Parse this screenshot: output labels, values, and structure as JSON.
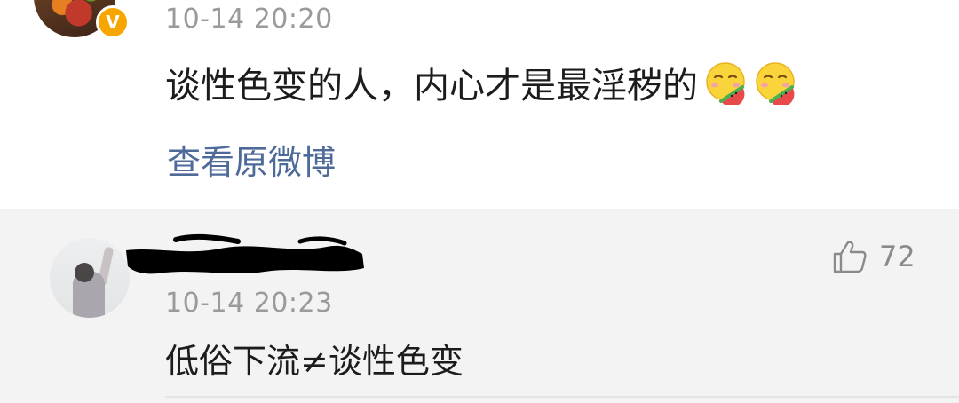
{
  "top_comment": {
    "timestamp": "10-14 20:20",
    "text": "谈性色变的人，内心才是最淫秽的",
    "emojis": [
      "melon-eating-emoji",
      "melon-eating-emoji"
    ],
    "link_label": "查看原微博",
    "badge_label": "V"
  },
  "reply": {
    "timestamp": "10-14 20:23",
    "text": "低俗下流≠谈性色变",
    "like_count": "72",
    "like_icon": "thumbs-up-icon"
  },
  "colors": {
    "link": "#4d6a99",
    "timestamp": "#9a9a9a",
    "reply_bg": "#f3f3f3",
    "badge": "#f7a600"
  }
}
